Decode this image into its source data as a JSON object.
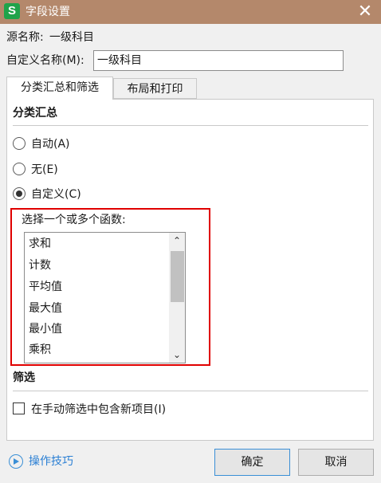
{
  "window": {
    "title": "字段设置",
    "close": "✕",
    "app_icon": "S"
  },
  "source": {
    "label": "源名称:",
    "value": "一级科目"
  },
  "custom_name": {
    "label": "自定义名称(M):",
    "value": "一级科目"
  },
  "tabs": [
    {
      "label": "分类汇总和筛选",
      "active": true
    },
    {
      "label": "布局和打印",
      "active": false
    }
  ],
  "subtotal": {
    "title": "分类汇总",
    "options": [
      {
        "label": "自动(A)",
        "checked": false
      },
      {
        "label": "无(E)",
        "checked": false
      },
      {
        "label": "自定义(C)",
        "checked": true
      }
    ],
    "functions_label": "选择一个或多个函数:",
    "functions": [
      "求和",
      "计数",
      "平均值",
      "最大值",
      "最小值",
      "乘积"
    ]
  },
  "filter": {
    "title": "筛选",
    "checkbox_label": "在手动筛选中包含新项目(I)",
    "checked": false
  },
  "footer": {
    "help_link": "操作技巧",
    "ok": "确定",
    "cancel": "取消"
  },
  "colors": {
    "titlebar": "#b4886b",
    "highlight": "#e00000",
    "link": "#2a7fd4"
  },
  "icons": {
    "scroll_up": "⌃",
    "scroll_down": "⌄"
  }
}
